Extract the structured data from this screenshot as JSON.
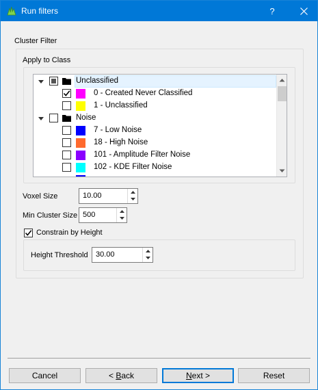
{
  "window": {
    "title": "Run filters",
    "help": "?"
  },
  "cluster_filter": {
    "group_title": "Cluster Filter",
    "apply_to_class_label": "Apply to Class",
    "tree": [
      {
        "name": "Unclassified",
        "kind": "group",
        "expanded": true,
        "check": "partial"
      },
      {
        "name": "0 - Created Never Classified",
        "kind": "item",
        "check": "checked",
        "color": "#ff00ff"
      },
      {
        "name": "1 - Unclassified",
        "kind": "item",
        "check": "unchecked",
        "color": "#ffff00"
      },
      {
        "name": "Noise",
        "kind": "group",
        "expanded": true,
        "check": "unchecked"
      },
      {
        "name": "7 - Low Noise",
        "kind": "item",
        "check": "unchecked",
        "color": "#0000ff"
      },
      {
        "name": "18 - High Noise",
        "kind": "item",
        "check": "unchecked",
        "color": "#ff6a2e"
      },
      {
        "name": "101 - Amplitude Filter Noise",
        "kind": "item",
        "check": "unchecked",
        "color": "#8b00ff"
      },
      {
        "name": "102 - KDE Filter Noise",
        "kind": "item",
        "check": "unchecked",
        "color": "#00ffff"
      }
    ],
    "voxel_size_label": "Voxel Size",
    "voxel_size_value": "10.00",
    "min_cluster_label": "Min Cluster Size",
    "min_cluster_value": "500",
    "constrain_label": "Constrain by Height",
    "constrain_checked": true,
    "height_threshold_label": "Height Threshold",
    "height_threshold_value": "30.00"
  },
  "buttons": {
    "cancel": "Cancel",
    "back_prefix": "< ",
    "back_mnemonic": "B",
    "back_rest": "ack",
    "next_mnemonic": "N",
    "next_rest": "ext >",
    "reset": "Reset"
  }
}
